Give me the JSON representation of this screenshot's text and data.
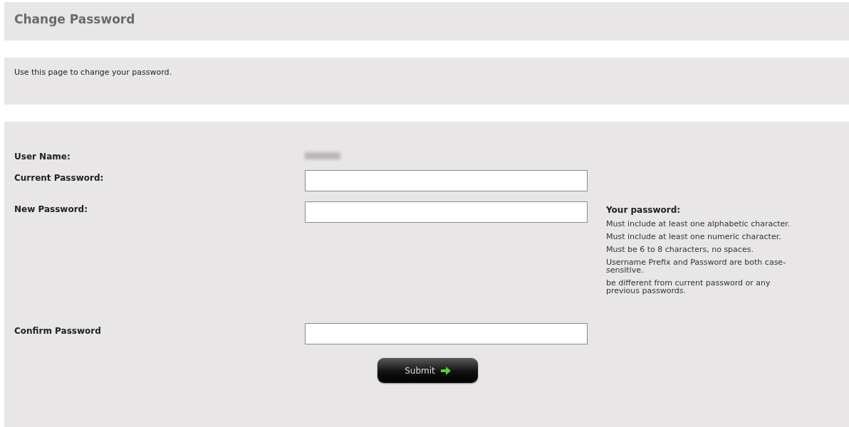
{
  "title": "Change Password",
  "intro": "Use this page to change your password.",
  "rows": [
    {
      "kind": "readonly",
      "label": "User Name:"
    },
    {
      "kind": "input",
      "label": "Current Password:"
    },
    {
      "kind": "input",
      "label": "New Password:"
    }
  ],
  "rules": {
    "heading": "Your password:",
    "items": [
      "Must include at least one alphabetic character.",
      "Must include at least one numeric character.",
      "Must be 6 to 8 characters, no spaces.",
      "Username Prefix and Password are both case-sensitive.",
      "be different from current password or any previous passwords."
    ]
  },
  "confirm": {
    "label": "Confirm Password"
  },
  "submit": "Submit"
}
